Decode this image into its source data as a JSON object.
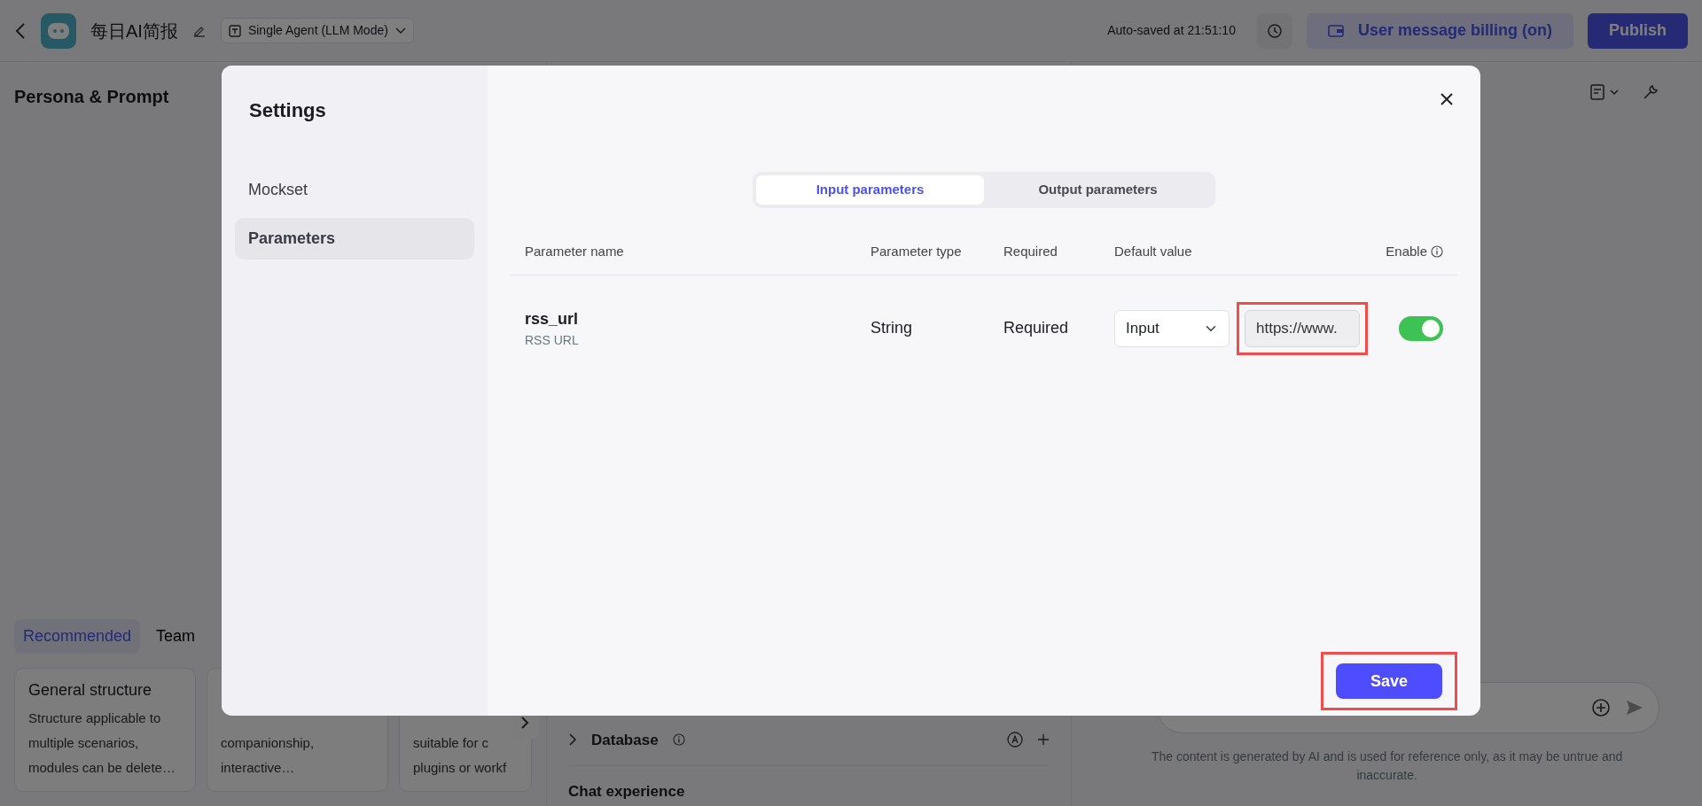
{
  "header": {
    "title": "每日AI简报",
    "mode": "Single Agent (LLM Mode)",
    "autosave": "Auto-saved at 21:51:10",
    "billing_button": "User message billing (on)",
    "publish_button": "Publish"
  },
  "persona": {
    "title": "Persona & Prompt",
    "tabs": [
      {
        "label": "Recommended",
        "selected": true
      },
      {
        "label": "Team",
        "selected": false
      }
    ],
    "cards": [
      {
        "title": "General structure",
        "description": "Structure applicable to\nmultiple scenarios,\nmodules can be delete…"
      },
      {
        "description": "companionship,\ninteractive…"
      },
      {
        "description": "suitable for c\nplugins or workf"
      }
    ]
  },
  "skills": {
    "items": [
      {
        "label": "Database",
        "expanded": false
      }
    ],
    "section": "Chat experience"
  },
  "preview": {
    "disclaimer": "The content is generated by AI and is used for reference only, as it may be untrue and inaccurate."
  },
  "modal": {
    "title": "Settings",
    "menu": [
      {
        "label": "Mockset",
        "selected": false
      },
      {
        "label": "Parameters",
        "selected": true
      }
    ],
    "tabs": [
      {
        "label": "Input parameters",
        "selected": true
      },
      {
        "label": "Output parameters",
        "selected": false
      }
    ],
    "columns": [
      "Parameter name",
      "Parameter type",
      "Required",
      "Default value",
      "Enable"
    ],
    "rows": [
      {
        "name": "rss_url",
        "description": "RSS URL",
        "type": "String",
        "required": "Required",
        "default_source": "Input",
        "default_value": "https://www.",
        "highlighted": true,
        "enabled": true
      }
    ],
    "save_button": {
      "label": "Save",
      "highlighted": true
    }
  }
}
